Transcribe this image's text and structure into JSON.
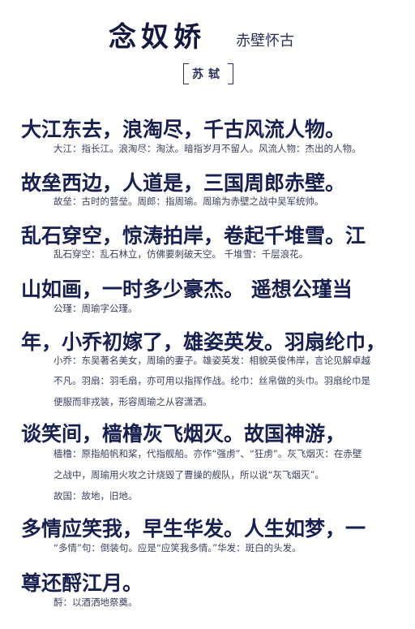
{
  "title": "念奴娇",
  "subtitle": "赤壁怀古",
  "author": "苏轼",
  "verses": [
    {
      "line": "大江东去，浪淘尽，千古风流人物。",
      "notes": [
        "大江：指长江。浪淘尽：淘汰。暗指岁月不留人。风流人物：杰出的人物。"
      ]
    },
    {
      "line": "故垒西边，人道是，三国周郎赤壁。",
      "notes": [
        "故垒：古时的营垒。周郎：指周瑜。周瑜为赤壁之战中吴军统帅。"
      ]
    },
    {
      "line": "乱石穿空，惊涛拍岸，卷起千堆雪。江",
      "notes": [
        "乱石穿空：乱石林立，仿佛要刺破天空。  千堆雪：千层浪花。"
      ]
    },
    {
      "line": "山如画，一时多少豪杰。      遥想公瑾当",
      "notes": [
        "公瑾：周瑜字公瑾。"
      ]
    },
    {
      "line": "年，小乔初嫁了，雄姿英发。羽扇纶巾，",
      "notes": [
        "小乔：东吴著名美女，周瑜的妻子。雄姿英发：相貌英俊伟岸，言论见解卓越",
        "不凡。羽扇：羽毛扇，亦可用以指挥作战。纶巾：丝帛做的头巾。羽扇纶巾是",
        "便服而非戎装，形容周瑜之从容潇洒。"
      ]
    },
    {
      "line": "谈笑间，樯橹灰飞烟灭。故国神游，",
      "notes": [
        "樯橹：原指船帆和桨，代指舰船。亦作“强虏”、“狂虏”。灰飞烟灭：在赤壁",
        "之战中，周瑜用火攻之计烧毁了曹操的舰队，所以说“灰飞烟灭”。",
        "故国：故地，旧地。"
      ]
    },
    {
      "line": "多情应笑我，早生华发。人生如梦，一",
      "notes": [
        "“多情”句：倒装句。应是“应笑我多情。”华发：斑白的头发。"
      ]
    },
    {
      "line": "尊还酹江月。",
      "notes": [
        "酹：以酒洒地祭奠。"
      ]
    }
  ]
}
